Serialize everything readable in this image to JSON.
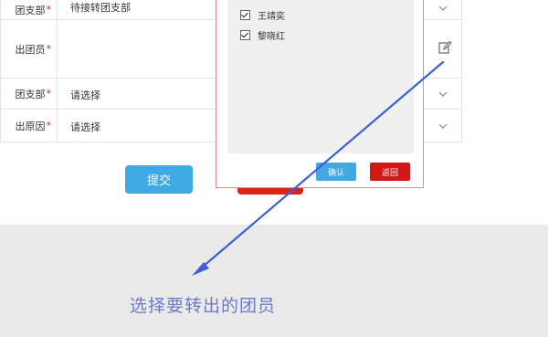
{
  "form": {
    "rows": [
      {
        "label": "团支部",
        "value": "待接转团支部"
      },
      {
        "label": "出团员",
        "value": ""
      },
      {
        "label": "团支部",
        "value": "请选择"
      },
      {
        "label": "出原因",
        "value": "请选择"
      }
    ],
    "required_mark": "*",
    "submit_label": "提交"
  },
  "modal": {
    "members": [
      "王靖奕",
      "黎晓红"
    ],
    "confirm_label": "确认",
    "back_label": "返回"
  },
  "annotation": {
    "caption": "选择要转出的团员"
  },
  "colors": {
    "primary": "#3fa9e4",
    "danger": "#d01818",
    "arrow": "#3d5fd6"
  },
  "icons": {
    "dropdown": "chevron-down-icon",
    "edit": "edit-icon",
    "check": "checkbox-checked-icon"
  }
}
